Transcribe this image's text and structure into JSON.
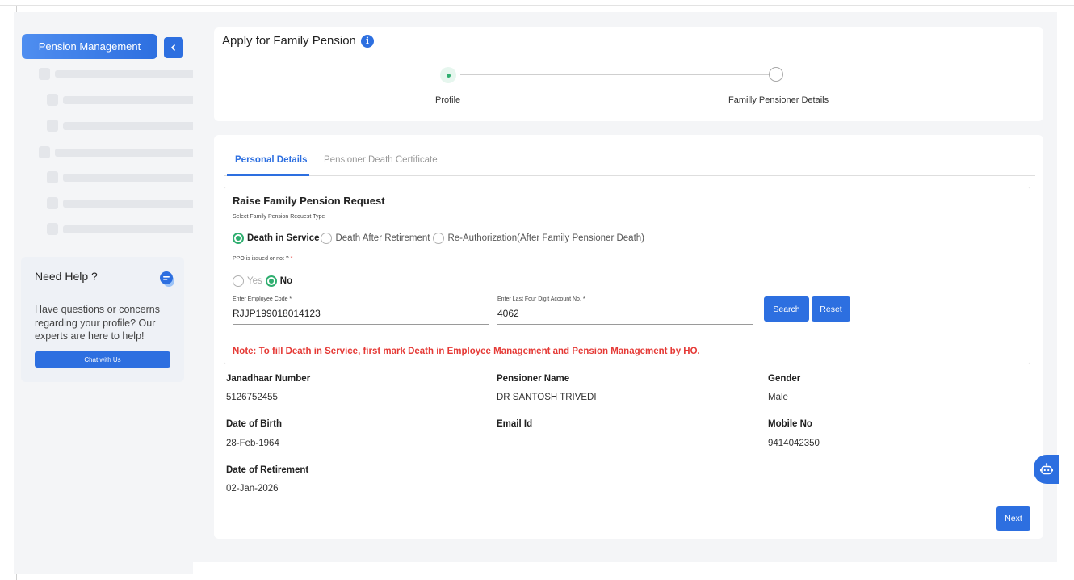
{
  "sidebar": {
    "nav_button_label": "Pension Management",
    "collapse_icon": "chevron-left-icon",
    "help": {
      "title": "Need Help ?",
      "text": "Have questions or concerns regarding your profile? Our experts are here to help!",
      "chat_button": "Chat with Us",
      "icon": "chat-bubble-icon"
    }
  },
  "header": {
    "title": "Apply for Family Pension",
    "info_icon": "info-icon"
  },
  "stepper": {
    "steps": [
      {
        "label": "Profile",
        "state": "active"
      },
      {
        "label": "Familly Pensioner Details",
        "state": "pending"
      }
    ]
  },
  "tabs": [
    {
      "label": "Personal Details",
      "active": true
    },
    {
      "label": "Pensioner Death Certificate",
      "active": false
    }
  ],
  "request": {
    "title": "Raise Family Pension Request",
    "type_label": "Select Family Pension Request Type",
    "type_options": [
      {
        "label": "Death in Service",
        "selected": true
      },
      {
        "label": "Death After Retirement",
        "selected": false
      },
      {
        "label": "Re-Authorization(After Family Pensioner Death)",
        "selected": false
      }
    ],
    "ppo_label": "PPO is issued or not ?",
    "required_star": "*",
    "ppo_options": [
      {
        "label": "Yes",
        "selected": false
      },
      {
        "label": "No",
        "selected": true
      }
    ],
    "employee_code": {
      "label": "Enter Employee Code *",
      "value": "RJJP199018014123"
    },
    "account_no": {
      "label": "Enter Last Four Digit Account No. *",
      "value": "4062"
    },
    "search_button": "Search",
    "reset_button": "Reset",
    "note": "Note: To fill Death in Service, first mark Death in Employee Management and Pension Management by HO."
  },
  "details": {
    "janadhaar_label": "Janadhaar Number",
    "janadhaar_value": "5126752455",
    "pensioner_name_label": "Pensioner Name",
    "pensioner_name_value": "DR SANTOSH TRIVEDI",
    "gender_label": "Gender",
    "gender_value": "Male",
    "dob_label": "Date of Birth",
    "dob_value": "28-Feb-1964",
    "email_label": "Email Id",
    "email_value": "",
    "mobile_label": "Mobile No",
    "mobile_value": "9414042350",
    "retirement_label": "Date of Retirement",
    "retirement_value": "02-Jan-2026"
  },
  "next_button": "Next",
  "chatbot_icon": "robot-icon",
  "colors": {
    "accent": "#2d6fe0",
    "success": "#2fae6f",
    "error": "#e53935",
    "background": "#f4f5f7"
  }
}
